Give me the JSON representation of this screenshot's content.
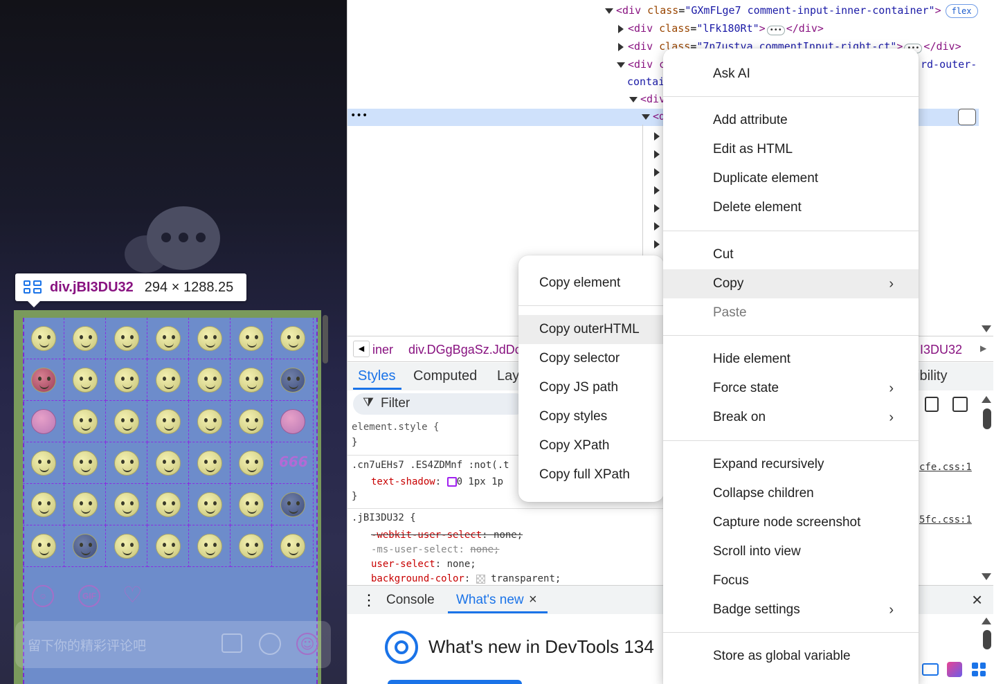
{
  "tooltip": {
    "element_name": "div.jBI3DU32",
    "size": "294 × 1288.25"
  },
  "emoji_panel": {
    "grid": [
      [
        "face",
        "face",
        "face",
        "face",
        "face",
        "face",
        "face"
      ],
      [
        "red",
        "face",
        "face",
        "face",
        "face",
        "face",
        "blue"
      ],
      [
        "pink",
        "face",
        "face",
        "face",
        "face",
        "face",
        "pink"
      ],
      [
        "face",
        "face",
        "face",
        "face",
        "face",
        "face",
        "666"
      ],
      [
        "face",
        "face",
        "face",
        "face",
        "face",
        "face",
        "blue"
      ],
      [
        "face",
        "blue",
        "face",
        "face",
        "face",
        "face",
        "face"
      ]
    ],
    "label_666": "666",
    "gif_label": "GIF",
    "comment_placeholder": "留下你的精彩评论吧"
  },
  "elements_tree": {
    "line1_tag": "div",
    "line1_class_attr": "class",
    "line1_class_val": "\"GXmFLge7 comment-input-inner-container\"",
    "line1_badge": "flex",
    "line2_class_val": "\"lFk180Rt\"",
    "line2_close": "</div>",
    "line3_class_val": "\"7n7ustva commentInput-right-ct\"",
    "line3_close": "</div>",
    "line4_left": "<div c",
    "line4_right": "rd-outer-",
    "line5_left": "contai",
    "line6_left": "<div",
    "line7_left": "<d",
    "selected_ellipsis": "•••"
  },
  "breadcrumbs": {
    "left": "iner",
    "middle": "div.DGgBgaSz.JdDc",
    "right": "I3DU32"
  },
  "panel_tabs": {
    "styles": "Styles",
    "computed": "Computed",
    "layout": "Layo",
    "accessibility": "ibility"
  },
  "filter": {
    "label": "Filter"
  },
  "styles_pane": {
    "rule1_selector": "element.style {",
    "rule1_close": "}",
    "rule2_selector": ".cn7uEHs7 .ES4ZDMnf :not(.t",
    "rule2_prop": "text-shadow",
    "rule2_value": "0 1px 1p",
    "rule2_close": "}",
    "rule2_source": "cfe.css:1",
    "rule3_selector": ".jBI3DU32 {",
    "rule3_source": "5fc.css:1",
    "rule3_props": [
      {
        "name": "-webkit-user-select",
        "value": "none;",
        "struck": true
      },
      {
        "name": "-ms-user-select",
        "value": "none;",
        "struck": true
      },
      {
        "name": "user-select",
        "value": "none;",
        "struck": false
      },
      {
        "name": "background-color",
        "value": "transparent;",
        "struck": false
      }
    ]
  },
  "drawer": {
    "console_tab": "Console",
    "whatsnew_tab": "What's new",
    "headline": "What's new in DevTools 134"
  },
  "context_menu": {
    "items": [
      {
        "label": "Ask AI",
        "submenu": false
      },
      {
        "label": "Add attribute",
        "submenu": false
      },
      {
        "label": "Edit as HTML",
        "submenu": false
      },
      {
        "label": "Duplicate element",
        "submenu": false
      },
      {
        "label": "Delete element",
        "submenu": false
      },
      {
        "label": "Cut",
        "submenu": false
      },
      {
        "label": "Copy",
        "submenu": true,
        "highlighted": true
      },
      {
        "label": "Paste",
        "submenu": false,
        "disabled": true
      },
      {
        "label": "Hide element",
        "submenu": false
      },
      {
        "label": "Force state",
        "submenu": true
      },
      {
        "label": "Break on",
        "submenu": true
      },
      {
        "label": "Expand recursively",
        "submenu": false
      },
      {
        "label": "Collapse children",
        "submenu": false
      },
      {
        "label": "Capture node screenshot",
        "submenu": false
      },
      {
        "label": "Scroll into view",
        "submenu": false
      },
      {
        "label": "Focus",
        "submenu": false
      },
      {
        "label": "Badge settings",
        "submenu": true
      },
      {
        "label": "Store as global variable",
        "submenu": false
      }
    ],
    "chevron": "›"
  },
  "copy_submenu": {
    "items": [
      {
        "label": "Copy element"
      },
      {
        "label": "Copy outerHTML",
        "highlighted": true
      },
      {
        "label": "Copy selector"
      },
      {
        "label": "Copy JS path"
      },
      {
        "label": "Copy styles"
      },
      {
        "label": "Copy XPath"
      },
      {
        "label": "Copy full XPath"
      }
    ]
  },
  "colors": {
    "tag": "#881280",
    "attr": "#994500",
    "value": "#1a1aa6",
    "selection": "#cfe1fb",
    "accent": "#1a73e8"
  }
}
